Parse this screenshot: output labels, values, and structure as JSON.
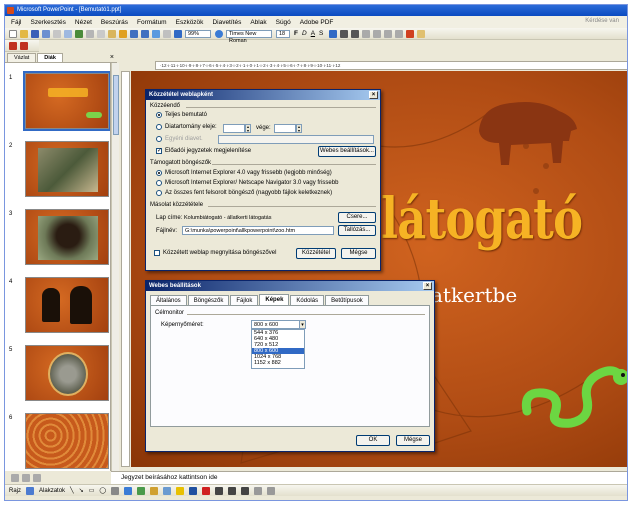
{
  "window": {
    "title": "Microsoft PowerPoint - [Bemutató1.ppt]"
  },
  "menu": {
    "items": [
      "Fájl",
      "Szerkesztés",
      "Nézet",
      "Beszúrás",
      "Formátum",
      "Eszközök",
      "Diavetítés",
      "Ablak",
      "Súgó",
      "Adobe PDF"
    ],
    "help_placeholder": "Kérdése van"
  },
  "toolbar": {
    "zoom": "99%",
    "font": "Times New Roman",
    "size": "18",
    "style_labels": [
      "F",
      "D",
      "A",
      "S"
    ]
  },
  "pane": {
    "tabs": [
      "Vázlat",
      "Diák"
    ],
    "close": "×",
    "slide_numbers": [
      "1",
      "2",
      "3",
      "4",
      "5",
      "6"
    ]
  },
  "ruler": {
    "text": "·12·ı·11·ı·10·ı·9·ı·8·ı·7·ı·6·ı·5·ı·4·ı·3·ı·2·ı·1·ı·0·ı·1·ı·2·ı·3·ı·4·ı·5·ı·6·ı·7·ı·8·ı·9·ı·10·ı·11·ı·12"
  },
  "slide": {
    "title": "látogató",
    "subtitle": "atkertbe"
  },
  "notes": {
    "placeholder": "Jegyzet beírásához kattintson ide"
  },
  "drawbar": {
    "draw_label": "Rajz",
    "autoshapes_label": "Alakzatok"
  },
  "dlg1": {
    "title": "Közzététel weblapként",
    "group_publish": "Közzéendő",
    "opt_full": "Teljes bemutató",
    "opt_range": "Diatartomány eleje:",
    "range_to": "vége:",
    "opt_custom": "Egyéni diavet.",
    "chk_notes": "Előadói jegyzetek megjelenítése",
    "btn_web_settings": "Webes beállítások...",
    "group_browsers": "Támogatott böngészők",
    "browser_1": "Microsoft Internet Explorer 4.0 vagy frissebb (legjobb minőség)",
    "browser_2": "Microsoft Internet Explorer/ Netscape Navigator 3.0 vagy frissebb",
    "browser_3": "Az összes fent felsorolt böngésző (nagyobb fájlok keletkeznek)",
    "group_copy": "Másolat közzététele",
    "page_title_label": "Lap címe:",
    "page_title_value": "Kolumbiát­ogató - állatkerti látogatás",
    "btn_change": "Csere...",
    "file_label": "Fájlnév:",
    "file_value": "G:\\munka\\powerpoint\\allkpowerpoint\\zoo.htm",
    "btn_browse": "Tallózás...",
    "chk_open": "Közzétett weblap megnyitása böngészővel",
    "btn_publish": "Közzététel",
    "btn_cancel": "Mégse"
  },
  "dlg2": {
    "title": "Webes beállítások",
    "tabs": [
      "Általános",
      "Böngészők",
      "Fájlok",
      "Képek",
      "Kódolás",
      "Betűtípusok"
    ],
    "group_target": "Célmonitor",
    "screen_label": "Képernyőméret:",
    "screen_value": "800 x 600",
    "options": [
      "544 x 376",
      "640 x 480",
      "720 x 512",
      "800 x 600",
      "1024 x 768",
      "1152 x 882"
    ],
    "selected_index": 3,
    "btn_ok": "OK",
    "btn_cancel": "Mégse"
  },
  "colors": {
    "slide_bg": "#b04c14",
    "title_fill": "#f6b324",
    "dialog_title": "#0a246a",
    "selection": "#316ac5"
  }
}
